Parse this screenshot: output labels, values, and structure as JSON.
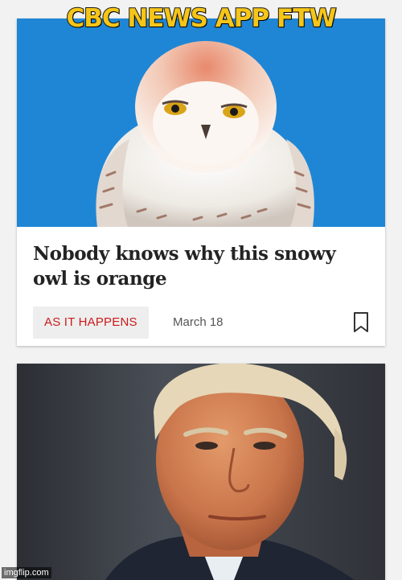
{
  "meme": {
    "caption": "CBC NEWS APP FTW",
    "watermark": "imgflip.com"
  },
  "article_1": {
    "image_subject": "snowy-owl-photo",
    "headline": "Nobody knows why this snowy owl is orange",
    "section": "AS IT HAPPENS",
    "date": "March 18",
    "colors": {
      "sky": "#1f86d6",
      "section_text": "#cc1a1a"
    }
  },
  "article_2": {
    "image_subject": "portrait-photo-man-in-suit"
  }
}
